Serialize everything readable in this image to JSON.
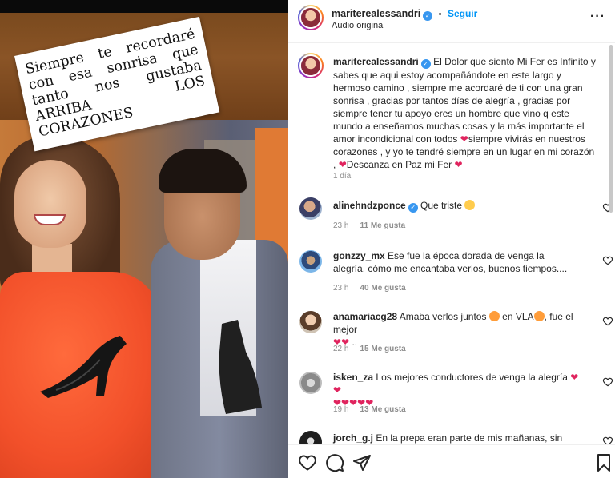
{
  "media": {
    "caption_text": "Siempre te recordaré con esa sonrisa que tanto nos gustaba ARRIBA LOS CORAZONES"
  },
  "header": {
    "username": "maritere alessandri",
    "username_display": "mariterealessandri",
    "follow_separator": "•",
    "follow_label": "Seguir",
    "audio_label": "Audio original",
    "more_icon": "more-options-icon"
  },
  "post": {
    "username": "mariterealessandri",
    "text": "El Dolor que siento Mi Fer es Infinito y sabes que aqui estoy acompañándote en este largo y hermoso camino , siempre me acordaré de ti con una gran sonrisa , gracias por tantos días de alegría , gracias por siempre tener tu apoyo eres un hombre que vino q este mundo a enseñarnos muchas cosas y la más importante el amor incondicional con todos",
    "text_2": "siempre vivirás en nuestros corazones , y yo te tendré siempre en un lugar en mi corazón ,",
    "text_3": "Descanza en Paz mi Fer",
    "time": "1 día"
  },
  "comments": [
    {
      "username": "alinehndzponce",
      "verified": true,
      "text": "Que triste",
      "time": "23 h",
      "likes": "11 Me gusta"
    },
    {
      "username": "gonzzy_mx",
      "verified": false,
      "text": "Ese fue la época dorada de venga la alegría, cómo me encantaba verlos, buenos tiempos....",
      "time": "23 h",
      "likes": "40 Me gusta"
    },
    {
      "username": "anamariacg28",
      "verified": false,
      "text": "Amaba verlos juntos",
      "text_b": "en VLA",
      "text_c": ", fue el mejor",
      "text_d": "..",
      "time": "22 h",
      "likes": "15 Me gusta"
    },
    {
      "username": "isken_za",
      "verified": false,
      "text": "Los mejores conductores de venga la alegría",
      "time": "19 h",
      "likes": "13 Me gusta"
    },
    {
      "username": "jorch_g.j",
      "verified": false,
      "text": "En la prepa eran parte de mis mañanas, sin duda"
    }
  ],
  "actions": {
    "like_icon": "heart-icon",
    "comment_icon": "comment-icon",
    "share_icon": "share-icon",
    "save_icon": "bookmark-icon"
  },
  "colors": {
    "link": "#0095f6",
    "verified": "#3897f0",
    "heart": "#e0245e",
    "muted": "#8e8e8e"
  }
}
